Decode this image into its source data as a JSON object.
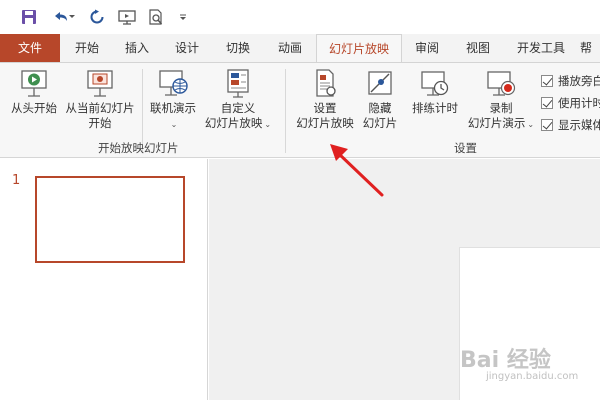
{
  "quick_access": {
    "icons": [
      "save-icon",
      "undo-icon",
      "redo-icon",
      "present-icon",
      "print-preview-icon",
      "customize-icon"
    ]
  },
  "tabs": [
    {
      "label": "文件"
    },
    {
      "label": "开始"
    },
    {
      "label": "插入"
    },
    {
      "label": "设计"
    },
    {
      "label": "切换"
    },
    {
      "label": "动画"
    },
    {
      "label": "幻灯片放映",
      "active": true
    },
    {
      "label": "审阅"
    },
    {
      "label": "视图"
    },
    {
      "label": "开发工具"
    },
    {
      "label": "帮"
    }
  ],
  "ribbon": {
    "group_start": {
      "label": "开始放映幻灯片",
      "from_beginning": "从头开始",
      "from_current_1": "从当前幻灯片",
      "from_current_2": "开始",
      "online": "联机演示",
      "custom_1": "自定义",
      "custom_2": "幻灯片放映"
    },
    "group_setup": {
      "label": "设置",
      "setup_1": "设置",
      "setup_2": "幻灯片放映",
      "hide_1": "隐藏",
      "hide_2": "幻灯片",
      "rehearse": "排练计时",
      "record_1": "录制",
      "record_2": "幻灯片演示",
      "checkboxes": [
        "播放旁白",
        "使用计时",
        "显示媒体"
      ]
    }
  },
  "slides": {
    "number": "1"
  },
  "watermark": {
    "text": "Bai 经验",
    "sub": "jingyan.baidu.com"
  },
  "colors": {
    "accent": "#b7472a",
    "arrow": "#e02020"
  }
}
